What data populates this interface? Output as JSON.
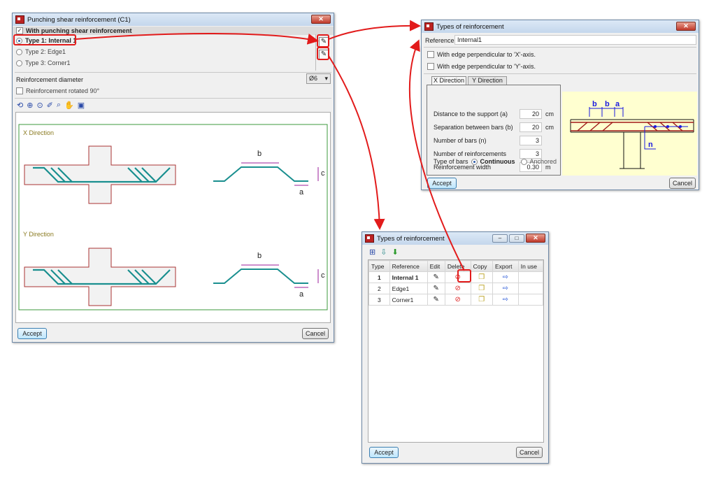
{
  "main_dialog": {
    "title": "Punching shear reinforcement (C1)",
    "close": "✕",
    "with_reinforcement": "With punching shear reinforcement",
    "types": [
      {
        "label": "Type  1: Internal 1",
        "selected": true
      },
      {
        "label": "Type 2: Edge1",
        "selected": false
      },
      {
        "label": "Type 3: Corner1",
        "selected": false
      }
    ],
    "diameter_label": "Reinforcement diameter",
    "diameter_value": "Ø6",
    "rotated_label": "Reinforcement rotated 90°",
    "x_direction": "X Direction",
    "y_direction": "Y Direction",
    "dim_b": "b",
    "dim_a": "a",
    "dim_c": "c",
    "accept": "Accept",
    "cancel": "Cancel"
  },
  "edit_dialog": {
    "title": "Types of reinforcement",
    "reference_label": "Reference",
    "reference_value": "Internal1",
    "edge_x": "With edge perpendicular to 'X'-axis.",
    "edge_y": "With edge perpendicular to 'Y'-axis.",
    "tabs": [
      "X Direction",
      "Y Direction"
    ],
    "fields": [
      {
        "label": "Distance to the support (a)",
        "value": "20",
        "unit": "cm"
      },
      {
        "label": "Separation between bars (b)",
        "value": "20",
        "unit": "cm"
      },
      {
        "label": "Number of bars (n)",
        "value": "3",
        "unit": ""
      },
      {
        "label": "Number of reinforcements",
        "value": "3",
        "unit": ""
      },
      {
        "label": "Reinforcement width",
        "value": "0.30",
        "unit": "m"
      }
    ],
    "bar_type_label": "Type of bars",
    "continuous": "Continuous",
    "anchored": "Anchored",
    "diagram_labels": {
      "b1": "b",
      "b2": "b",
      "a": "a",
      "n": "n"
    },
    "accept": "Accept",
    "cancel": "Cancel"
  },
  "list_dialog": {
    "title": "Types of reinforcement",
    "columns": [
      "Type",
      "Reference",
      "Edit",
      "Delete",
      "Copy",
      "Export",
      "In use"
    ],
    "rows": [
      {
        "type": "1",
        "reference": "Internal 1"
      },
      {
        "type": "2",
        "reference": "Edge1"
      },
      {
        "type": "3",
        "reference": "Corner1"
      }
    ],
    "accept": "Accept",
    "cancel": "Cancel"
  },
  "colors": {
    "annotation": "#e21b1b",
    "rebar": "#1a8f8f",
    "dimension": "#9b1e9b",
    "frame": "#3c9a3c",
    "diagram_bg": "#ffffd0"
  }
}
